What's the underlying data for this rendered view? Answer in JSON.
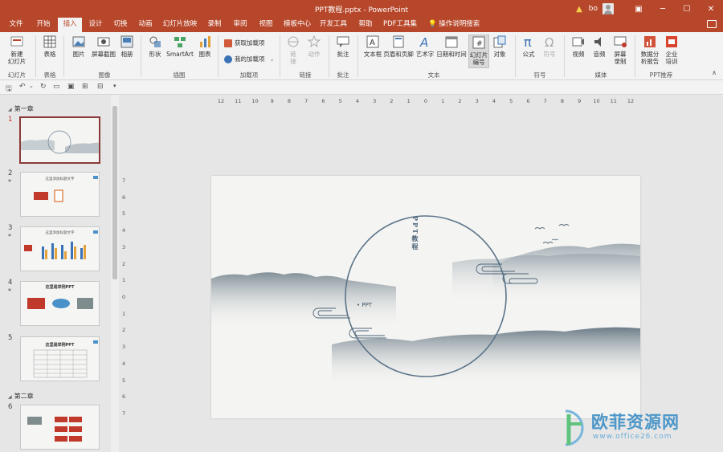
{
  "window": {
    "title": "PPT教程.pptx  -  PowerPoint",
    "user": "bo"
  },
  "tabs": [
    "文件",
    "开始",
    "插入",
    "设计",
    "切换",
    "动画",
    "幻灯片放映",
    "录制",
    "审阅",
    "视图",
    "模板中心",
    "开发工具",
    "帮助",
    "PDF工具集"
  ],
  "active_tab": "插入",
  "search_label": "操作说明搜索",
  "ribbon": {
    "new_slide": [
      "新建",
      "幻灯片"
    ],
    "table": "表格",
    "picture": "图片",
    "screenshot": "屏幕截图",
    "album": "相册",
    "shapes": "形状",
    "smartart": "SmartArt",
    "chart": "图表",
    "get_addins": "获取加载项",
    "my_addins": "我的加载项",
    "link": [
      "链",
      "接"
    ],
    "action": "动作",
    "comment": "批注",
    "textbox": "文本框",
    "header_footer": "页眉和页脚",
    "wordart": "艺术字",
    "datetime": "日期和时间",
    "slide_number": [
      "幻灯片",
      "编号"
    ],
    "object": "对象",
    "equation": "公式",
    "symbol": "符号",
    "video": "视频",
    "audio": "音频",
    "screen_record": [
      "屏幕",
      "录制"
    ],
    "data_analysis": [
      "数据分",
      "析报告"
    ],
    "enterprise_training": [
      "企业",
      "培训"
    ],
    "groups": {
      "slides": "幻灯片",
      "tables": "表格",
      "images": "图像",
      "illustrations": "插图",
      "addins": "加载项",
      "links": "链接",
      "comments": "批注",
      "text": "文本",
      "symbols": "符号",
      "media": "媒体",
      "ppt_recommend": "PPT推荐"
    }
  },
  "sections": [
    "第一章",
    "第二章"
  ],
  "thumbnails": [
    {
      "num": "1",
      "star": "",
      "title": ""
    },
    {
      "num": "2",
      "star": "*",
      "title": "这里添加标题文字"
    },
    {
      "num": "3",
      "star": "*",
      "title": "这里添加标题文字"
    },
    {
      "num": "4",
      "star": "*",
      "title": "这里是举例PPT"
    },
    {
      "num": "5",
      "star": "",
      "title": "这里是举例PPT"
    },
    {
      "num": "6",
      "star": "",
      "title": ""
    }
  ],
  "ruler_h": [
    "12",
    "11",
    "10",
    "9",
    "8",
    "7",
    "6",
    "5",
    "4",
    "3",
    "2",
    "1",
    "0",
    "1",
    "2",
    "3",
    "4",
    "5",
    "6",
    "7",
    "8",
    "9",
    "10",
    "11",
    "12"
  ],
  "ruler_v": [
    "7",
    "6",
    "5",
    "4",
    "3",
    "2",
    "1",
    "0",
    "1",
    "2",
    "3",
    "4",
    "5",
    "6",
    "7"
  ],
  "slide": {
    "vertical_title": "PPT教程",
    "label": "PPT"
  },
  "watermark": {
    "text": "欧菲资源网",
    "url": "www.office26.com"
  }
}
